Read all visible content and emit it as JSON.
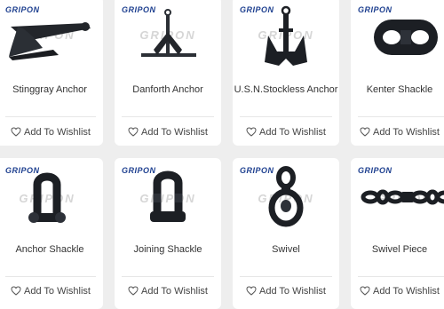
{
  "brand": "GRIPON",
  "watermark": "GRIPON",
  "wishlist_label": "Add To Wishlist",
  "heart_icon": "heart-outline-icon",
  "colors": {
    "brand": "#1d3f8f",
    "product": "#1c1f24",
    "page_bg": "#eeeeee"
  },
  "products": [
    {
      "name": "Stinggray Anchor"
    },
    {
      "name": "Danforth Anchor"
    },
    {
      "name": "U.S.N.Stockless Anchor"
    },
    {
      "name": "Kenter Shackle"
    },
    {
      "name": "Anchor Shackle"
    },
    {
      "name": "Joining Shackle"
    },
    {
      "name": "Swivel"
    },
    {
      "name": "Swivel Piece"
    }
  ]
}
